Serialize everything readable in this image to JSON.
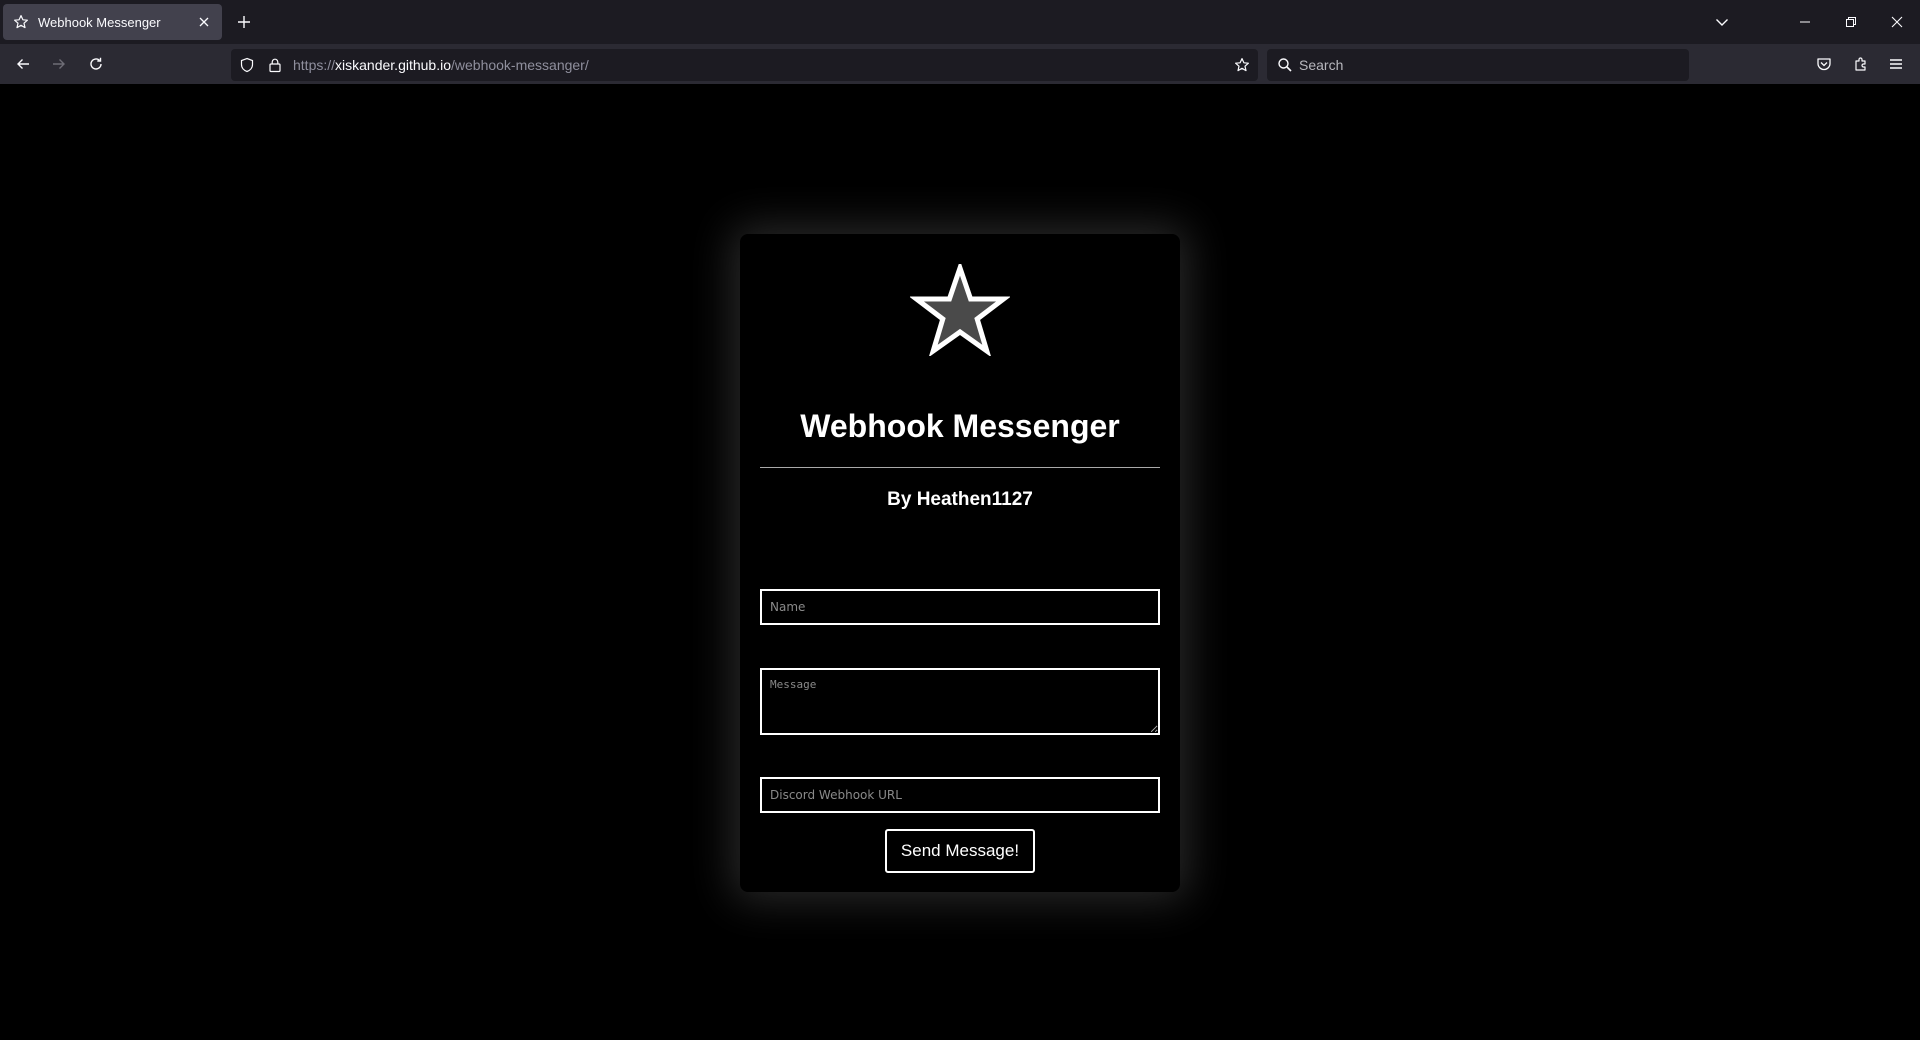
{
  "browser": {
    "tab": {
      "title": "Webhook Messenger",
      "favicon": "star-icon"
    },
    "address": {
      "scheme": "https://",
      "host": "xiskander.github.io",
      "path": "/webhook-messanger/"
    },
    "search": {
      "placeholder": "Search"
    },
    "icons": {
      "back": "arrow-left-icon",
      "forward": "arrow-right-icon",
      "reload": "reload-icon",
      "tracking_protection": "shield-icon",
      "secure": "lock-icon",
      "bookmark": "star-icon",
      "pocket": "pocket-icon",
      "extensions": "puzzle-icon",
      "menu": "hamburger-icon"
    }
  },
  "page": {
    "logo": "star-icon",
    "title": "Webhook Messenger",
    "subtitle": "By Heathen1127",
    "form": {
      "name": {
        "value": "",
        "placeholder": "Name"
      },
      "message": {
        "value": "",
        "placeholder": "Message"
      },
      "webhook_url": {
        "value": "",
        "placeholder": "Discord Webhook URL"
      },
      "submit_label": "Send Message!"
    }
  },
  "colors": {
    "page_background": "#000000",
    "text": "#ffffff",
    "card_glow": "#ffffff",
    "chrome_tabbar": "#1c1b22",
    "chrome_toolbar": "#2b2a33"
  }
}
